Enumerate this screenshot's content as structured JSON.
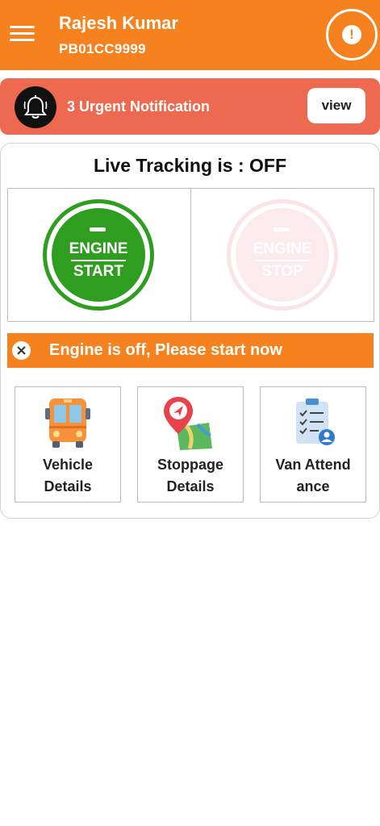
{
  "header": {
    "user_name": "Rajesh Kumar",
    "vehicle_number": "PB01CC9999",
    "background_color": "#f5821f",
    "menu_icon": "hamburger-menu-icon",
    "alert_icon": "exclamation-circle-icon"
  },
  "notification": {
    "text": "3 Urgent Notification",
    "view_label": "view",
    "icon": "bell-icon",
    "background_color": "#ed6a50"
  },
  "tracking": {
    "title": "Live Tracking is : OFF"
  },
  "engine": {
    "start_line1": "ENGINE",
    "start_line2": "START",
    "stop_line1": "ENGINE",
    "stop_line2": "STOP",
    "start_color": "#2f9e20",
    "stop_color": "#fcebed"
  },
  "status": {
    "text": "Engine is off, Please start now",
    "icon": "close-circle-icon"
  },
  "tiles": [
    {
      "line1": "Vehicle",
      "line2": "Details",
      "icon": "bus-icon"
    },
    {
      "line1": "Stoppage",
      "line2": "Details",
      "icon": "map-pin-icon"
    },
    {
      "line1": "Van Attend",
      "line2": "ance",
      "icon": "clipboard-checklist-icon"
    }
  ]
}
